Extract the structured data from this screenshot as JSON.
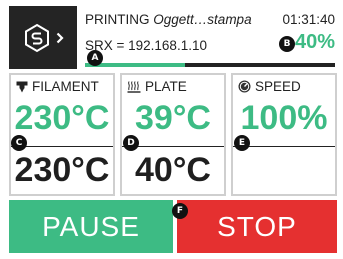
{
  "header": {
    "menu_icon": "logo-chevron-icon",
    "status": {
      "state": "PRINTING",
      "filename": "Oggett…stampa",
      "time": "01:31:40",
      "ip_text": "SRX = 192.168.1.10",
      "percent_text": "40%",
      "progress": 0.4
    }
  },
  "tiles": {
    "filament": {
      "label": "FILAMENT",
      "icon": "nozzle-icon",
      "current": "230°C",
      "target": "230°C"
    },
    "plate": {
      "label": "PLATE",
      "icon": "heat-bed-icon",
      "current": "39°C",
      "target": "40°C"
    },
    "speed": {
      "label": "SPEED",
      "icon": "gauge-icon",
      "current": "100%"
    }
  },
  "buttons": {
    "pause": "PAUSE",
    "stop": "STOP"
  },
  "callouts": {
    "a": "A",
    "b": "B",
    "c": "C",
    "d": "D",
    "e": "E",
    "f": "F"
  },
  "colors": {
    "accent": "#3dbb84",
    "danger": "#e53030",
    "dark": "#242424"
  }
}
